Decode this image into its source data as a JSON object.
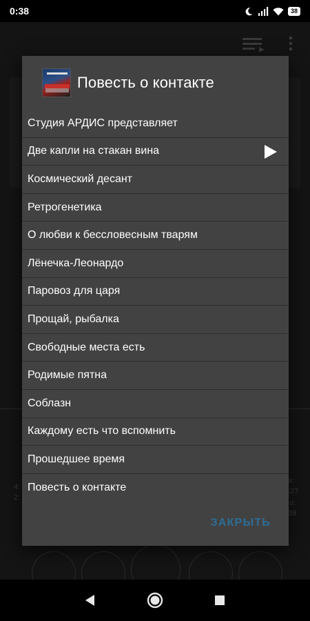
{
  "status_bar": {
    "time": "0:38",
    "battery": "38"
  },
  "background": {
    "side_left_top": "4:",
    "side_left_bottom": "2:",
    "side_right_top": "я:",
    "side_right_mid": ":27",
    "side_right_low": "о:",
    "side_right_bottom": "39"
  },
  "dialog": {
    "title": "Повесть о контакте",
    "items": [
      {
        "label": "Студия АРДИС представляет"
      },
      {
        "label": "Две капли на стакан вина"
      },
      {
        "label": "Космический десант"
      },
      {
        "label": "Ретрогенетика"
      },
      {
        "label": "О любви к бессловесным тварям"
      },
      {
        "label": "Лёнечка-Леонардо"
      },
      {
        "label": "Паровоз для царя"
      },
      {
        "label": "Прощай, рыбалка"
      },
      {
        "label": "Свободные места есть"
      },
      {
        "label": "Родимые пятна"
      },
      {
        "label": "Соблазн"
      },
      {
        "label": "Каждому есть что вспомнить"
      },
      {
        "label": "Прошедшее время"
      },
      {
        "label": "Повесть о контакте"
      }
    ],
    "playing_index": 1,
    "close_label": "ЗАКРЫТЬ"
  },
  "colors": {
    "dialog_bg": "#424242",
    "accent": "#2d6d95"
  }
}
